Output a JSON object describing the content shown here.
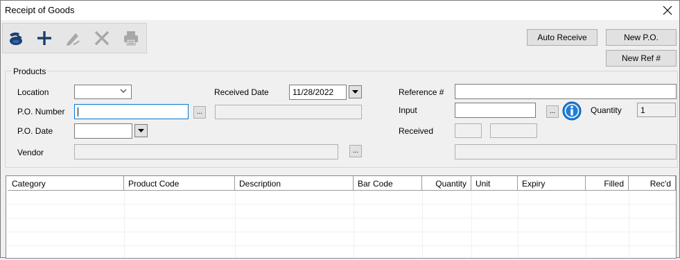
{
  "window": {
    "title": "Receipt of Goods"
  },
  "toolbar": {
    "icons": [
      "database-import-icon",
      "add-icon",
      "edit-pencil-icon",
      "delete-x-icon",
      "print-icon"
    ]
  },
  "buttons": {
    "auto_receive": "Auto Receive",
    "new_po": "New P.O.",
    "new_ref": "New Ref #"
  },
  "products": {
    "group_title": "Products",
    "location_label": "Location",
    "location_value": "",
    "po_number_label": "P.O. Number",
    "po_number_value": "",
    "po_number_desc": "",
    "po_date_label": "P.O. Date",
    "po_date_value": "",
    "vendor_label": "Vendor",
    "vendor_value": "",
    "received_date_label": "Received Date",
    "received_date_value": "11/28/2022",
    "reference_label": "Reference #",
    "reference_value": "",
    "input_label": "Input",
    "input_value": "",
    "quantity_label": "Quantity",
    "quantity_value": "1",
    "received_label": "Received",
    "received_a": "",
    "received_b": "",
    "info_line": "",
    "ellipsis": "..."
  },
  "grid": {
    "columns": [
      "Category",
      "Product Code",
      "Description",
      "Bar Code",
      "Quantity",
      "Unit",
      "Expiry",
      "Filled",
      "Rec'd"
    ],
    "rows": []
  },
  "colors": {
    "accent": "#0078d7",
    "info_icon": "#1e7fd8"
  }
}
